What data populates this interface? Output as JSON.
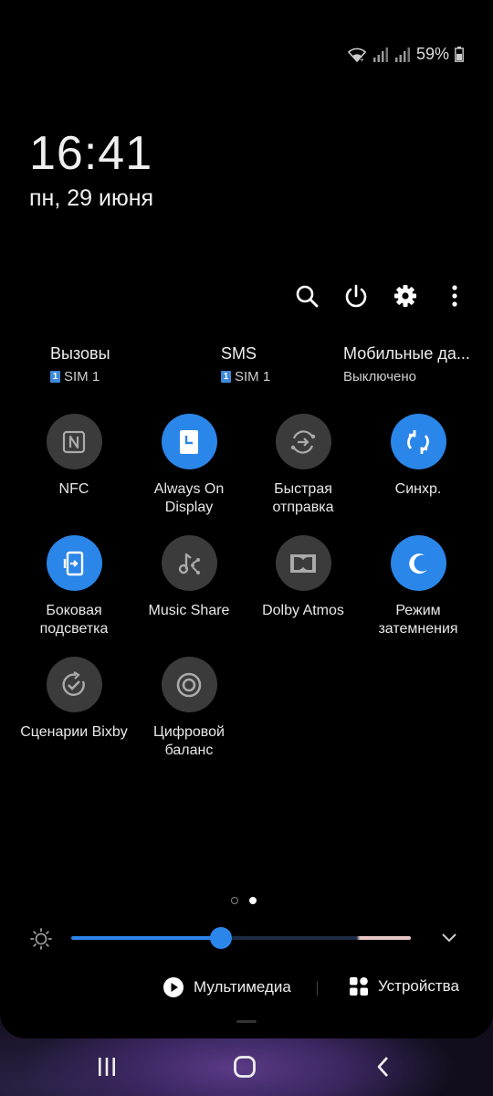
{
  "status": {
    "battery_text": "59%"
  },
  "clock": {
    "time": "16:41",
    "date": "пн, 29 июня"
  },
  "actions": [
    {
      "name": "search-button",
      "icon": "search-icon"
    },
    {
      "name": "power-button",
      "icon": "power-icon"
    },
    {
      "name": "settings-button",
      "icon": "gear-icon"
    },
    {
      "name": "more-button",
      "icon": "more-vertical-icon"
    }
  ],
  "sim": [
    {
      "title": "Вызовы",
      "sub": "SIM 1",
      "badge": "1"
    },
    {
      "title": "SMS",
      "sub": "SIM 1",
      "badge": "1"
    },
    {
      "title": "Мобильные да...",
      "sub": "Выключено"
    }
  ],
  "tiles": [
    {
      "label": "NFC",
      "state": "off",
      "icon": "nfc-icon"
    },
    {
      "label": "Always On Display",
      "state": "on",
      "icon": "clock-screen-icon"
    },
    {
      "label": "Быстрая отправка",
      "state": "off",
      "icon": "quick-share-icon"
    },
    {
      "label": "Синхр.",
      "state": "on",
      "icon": "sync-icon"
    },
    {
      "label": "Боковая подсветка",
      "state": "on",
      "icon": "edge-lighting-icon"
    },
    {
      "label": "Music Share",
      "state": "off",
      "icon": "music-share-icon"
    },
    {
      "label": "Dolby Atmos",
      "state": "off",
      "icon": "dolby-icon"
    },
    {
      "label": "Режим затемнения",
      "state": "on",
      "icon": "moon-icon"
    },
    {
      "label": "Сценарии Bixby",
      "state": "off",
      "icon": "bixby-routines-icon"
    },
    {
      "label": "Цифровой баланс",
      "state": "off",
      "icon": "digital-wellbeing-icon"
    }
  ],
  "pager": {
    "pages": 2,
    "current": 2
  },
  "brightness": {
    "level": 0.44
  },
  "bottom": {
    "media_label": "Мультимедиа",
    "devices_label": "Устройства"
  },
  "colors": {
    "accent": "#2a86e8",
    "tile_off": "#3b3b3b",
    "background": "#000000"
  }
}
